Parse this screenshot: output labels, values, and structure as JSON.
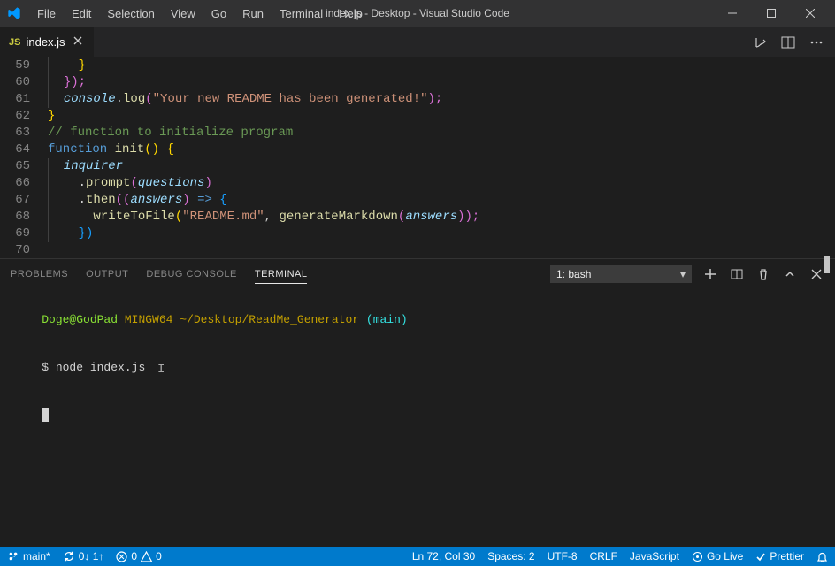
{
  "title": "index.js - Desktop - Visual Studio Code",
  "menu": [
    "File",
    "Edit",
    "Selection",
    "View",
    "Go",
    "Run",
    "Terminal",
    "Help"
  ],
  "tab": {
    "icon": "JS",
    "label": "index.js"
  },
  "lineNumbers": [
    "59",
    "60",
    "61",
    "62",
    "63",
    "64",
    "65",
    "66",
    "67",
    "68",
    "69",
    "70"
  ],
  "code": {
    "l59": "}",
    "l60a": "});",
    "l61a": "console",
    "l61b": ".",
    "l61c": "log",
    "l61d": "(",
    "l61e": "\"Your new README has been generated!\"",
    "l61f": ");",
    "l62": "}",
    "l63": "",
    "l64": "// function to initialize program",
    "l65a": "function",
    "l65b": " ",
    "l65c": "init",
    "l65d": "()",
    "l65e": " {",
    "l66": "inquirer",
    "l67a": ".",
    "l67b": "prompt",
    "l67c": "(",
    "l67d": "questions",
    "l67e": ")",
    "l68a": ".",
    "l68b": "then",
    "l68c": "((",
    "l68d": "answers",
    "l68e": ") ",
    "l68f": "=>",
    "l68g": " {",
    "l69a": "writeToFile",
    "l69b": "(",
    "l69c": "\"README.md\"",
    "l69d": ", ",
    "l69e": "generateMarkdown",
    "l69f": "(",
    "l69g": "answers",
    "l69h": "));",
    "l70": "})"
  },
  "panelTabs": [
    "PROBLEMS",
    "OUTPUT",
    "DEBUG CONSOLE",
    "TERMINAL"
  ],
  "activePanelTab": "TERMINAL",
  "terminalSelect": "1: bash",
  "terminal": {
    "user": "Doge@GodPad",
    "host": " MINGW64 ",
    "path": "~/Desktop/ReadMe_Generator ",
    "branch": "(main)",
    "prompt": "$ ",
    "cmd": "node index.js"
  },
  "status": {
    "branch": "main*",
    "sync": "0↓ 1↑",
    "errors": "0",
    "warnings": "0",
    "lncol": "Ln 72, Col 30",
    "spaces": "Spaces: 2",
    "encoding": "UTF-8",
    "eol": "CRLF",
    "lang": "JavaScript",
    "golive": "Go Live",
    "prettier": "Prettier"
  }
}
